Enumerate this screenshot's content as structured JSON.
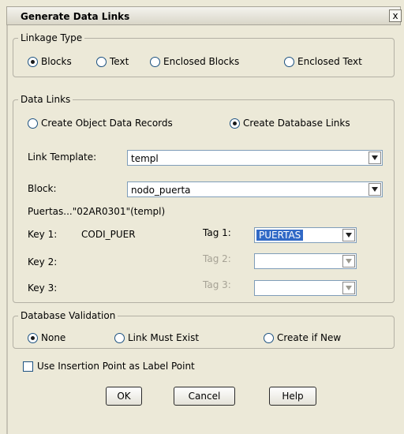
{
  "dialog": {
    "title": "Generate Data Links",
    "close_glyph": "x"
  },
  "linkage_type": {
    "legend": "Linkage Type",
    "options": [
      "Blocks",
      "Text",
      "Enclosed Blocks",
      "Enclosed Text"
    ],
    "selected": "Blocks"
  },
  "data_links": {
    "legend": "Data Links",
    "options": [
      "Create Object Data Records",
      "Create Database Links"
    ],
    "selected": "Create Database Links",
    "link_template_label": "Link Template:",
    "link_template_value": "templ",
    "block_label": "Block:",
    "block_value": "nodo_puerta",
    "info_text": "Puertas...\"02AR0301\"(templ)",
    "keys": [
      {
        "key_label": "Key 1:",
        "key_value": "CODI_PUER",
        "tag_label": "Tag 1:",
        "tag_value": "PUERTAS",
        "enabled": true
      },
      {
        "key_label": "Key 2:",
        "key_value": "",
        "tag_label": "Tag 2:",
        "tag_value": "",
        "enabled": false
      },
      {
        "key_label": "Key 3:",
        "key_value": "",
        "tag_label": "Tag 3:",
        "tag_value": "",
        "enabled": false
      }
    ]
  },
  "database_validation": {
    "legend": "Database Validation",
    "options": [
      "None",
      "Link Must Exist",
      "Create if New"
    ],
    "selected": "None"
  },
  "insertion_point_checkbox": {
    "label": "Use Insertion Point as Label Point",
    "checked": false
  },
  "buttons": {
    "ok": "OK",
    "cancel": "Cancel",
    "help": "Help"
  },
  "colors": {
    "dialog_bg": "#ece9d8",
    "selection": "#3169c6",
    "disabled_text": "#a6a295"
  }
}
